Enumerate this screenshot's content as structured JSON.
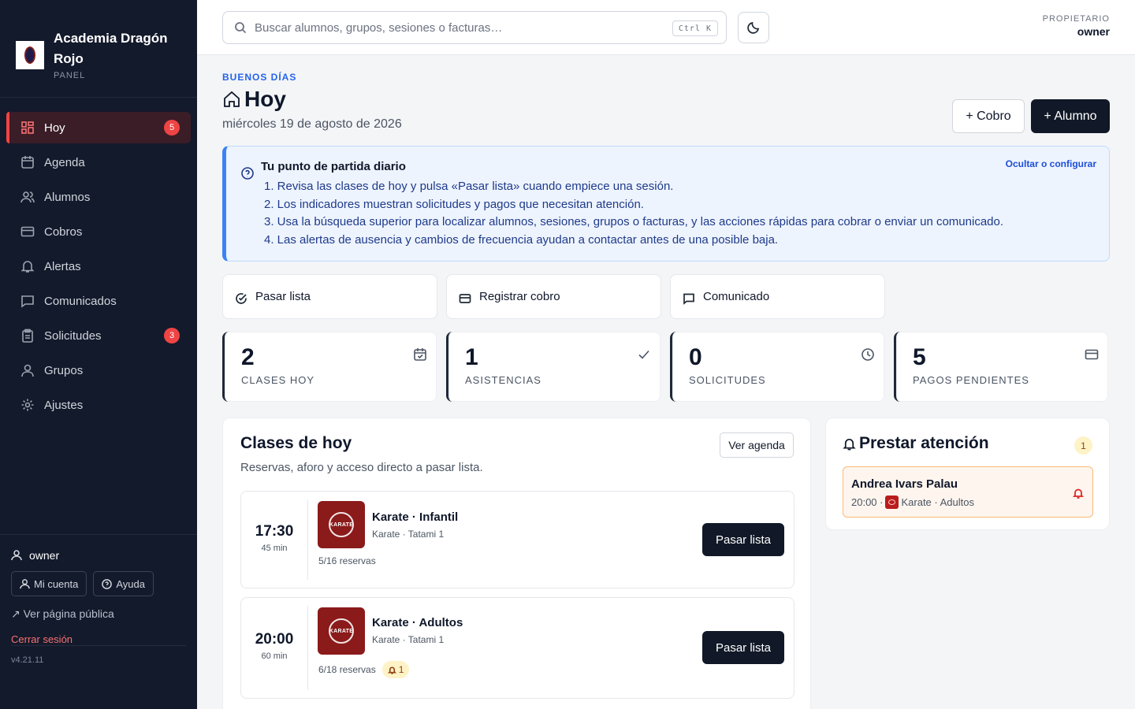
{
  "brand": {
    "name": "Academia Dragón Rojo",
    "subtitle": "PANEL"
  },
  "nav": [
    {
      "label": "Hoy",
      "badge": "5",
      "icon": "grid-icon",
      "active": true
    },
    {
      "label": "Agenda",
      "icon": "calendar-icon"
    },
    {
      "label": "Alumnos",
      "icon": "users-icon"
    },
    {
      "label": "Cobros",
      "icon": "card-icon"
    },
    {
      "label": "Alertas",
      "icon": "bell-icon"
    },
    {
      "label": "Comunicados",
      "icon": "message-icon"
    },
    {
      "label": "Solicitudes",
      "badge": "3",
      "icon": "clipboard-icon"
    },
    {
      "label": "Grupos",
      "icon": "group-icon"
    },
    {
      "label": "Ajustes",
      "icon": "gear-icon"
    }
  ],
  "sidebar_footer": {
    "user": "owner",
    "account_label": "Mi cuenta",
    "help_label": "Ayuda",
    "public_link": "↗ Ver página pública",
    "logout": "Cerrar sesión",
    "version": "v4.21.11"
  },
  "topbar": {
    "search_placeholder": "Buscar alumnos, grupos, sesiones o facturas…",
    "shortcut": "Ctrl K",
    "role_label": "PROPIETARIO",
    "role_name": "owner"
  },
  "header": {
    "greeting": "BUENOS DÍAS",
    "title": "Hoy",
    "date": "miércoles 19 de agosto de 2026",
    "btn_cobro": "+ Cobro",
    "btn_alumno": "+ Alumno"
  },
  "guide": {
    "title": "Tu punto de partida diario",
    "link": "Ocultar o configurar",
    "items": [
      "1. Revisa las clases de hoy y pulsa «Pasar lista» cuando empiece una sesión.",
      "2. Los indicadores muestran solicitudes y pagos que necesitan atención.",
      "3. Usa la búsqueda superior para localizar alumnos, sesiones, grupos o facturas, y las acciones rápidas para cobrar o enviar un comunicado.",
      "4. Las alertas de ausencia y cambios de frecuencia ayudan a contactar antes de una posible baja."
    ]
  },
  "quick_actions": [
    {
      "label": "Pasar lista",
      "icon": "check-circle-icon"
    },
    {
      "label": "Registrar cobro",
      "icon": "card-icon"
    },
    {
      "label": "Comunicado",
      "icon": "message-icon"
    }
  ],
  "stats": [
    {
      "value": "2",
      "label": "CLASES HOY",
      "icon": "calendar-check-icon"
    },
    {
      "value": "1",
      "label": "ASISTENCIAS",
      "icon": "check-icon"
    },
    {
      "value": "0",
      "label": "SOLICITUDES",
      "icon": "clock-icon"
    },
    {
      "value": "5",
      "label": "PAGOS PENDIENTES",
      "icon": "card-icon"
    }
  ],
  "classes": {
    "title": "Clases de hoy",
    "subtitle": "Reservas, aforo y acceso directo a pasar lista.",
    "agenda_btn": "Ver agenda",
    "sessions": [
      {
        "time": "17:30",
        "duration": "45 min",
        "name": "Karate · Infantil",
        "place": "Karate · Tatami 1",
        "reservations": "5/16 reservas",
        "alert": "",
        "logo_text": "KARATE",
        "action": "Pasar lista"
      },
      {
        "time": "20:00",
        "duration": "60 min",
        "name": "Karate · Adultos",
        "place": "Karate · Tatami 1",
        "reservations": "6/18 reservas",
        "alert": "1",
        "logo_text": "KARATE",
        "action": "Pasar lista"
      }
    ]
  },
  "attention": {
    "title": "Prestar atención",
    "count": "1",
    "items": [
      {
        "name": "Andrea Ivars Palau",
        "time": "20:00 ·",
        "group": "Karate · Adultos"
      }
    ]
  }
}
